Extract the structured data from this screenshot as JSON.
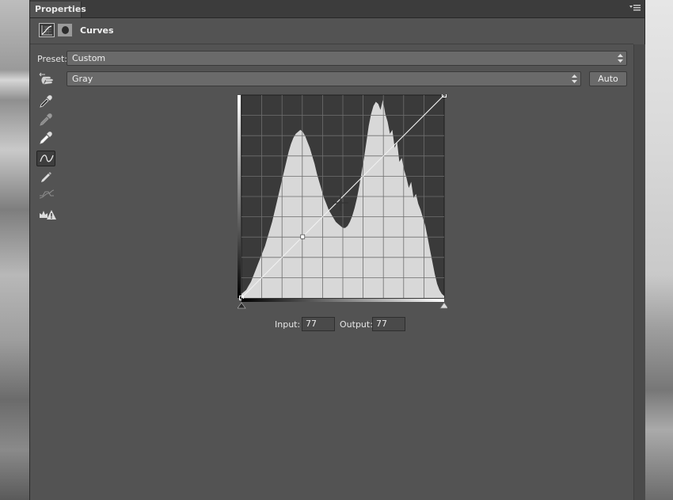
{
  "panel": {
    "tab_label": "Properties",
    "title": "Curves",
    "icons": {
      "panel_menu": "panel-menu-icon",
      "adjustment": "curves-adjustment-icon",
      "mask": "layer-mask-icon"
    }
  },
  "preset": {
    "label": "Preset:",
    "value": "Custom"
  },
  "channel": {
    "value": "Gray",
    "auto_label": "Auto"
  },
  "tools": [
    {
      "name": "on-image-adjustment-icon"
    },
    {
      "name": "black-point-eyedropper-icon"
    },
    {
      "name": "gray-point-eyedropper-icon"
    },
    {
      "name": "white-point-eyedropper-icon"
    },
    {
      "name": "edit-points-curve-icon",
      "active": true
    },
    {
      "name": "draw-curve-pencil-icon"
    },
    {
      "name": "smooth-curve-icon"
    },
    {
      "name": "clipping-warning-icon"
    }
  ],
  "curve": {
    "grid_divisions": 10,
    "input": "77",
    "output": "77",
    "input_label": "Input:",
    "output_label": "Output:",
    "points": [
      [
        0,
        0
      ],
      [
        77,
        77
      ],
      [
        255,
        255
      ]
    ],
    "histogram": [
      2,
      3,
      4,
      6,
      8,
      11,
      14,
      17,
      20,
      23,
      26,
      30,
      34,
      38,
      43,
      48,
      53,
      58,
      63,
      68,
      73,
      77,
      80,
      82,
      83,
      84,
      83,
      81,
      78,
      75,
      71,
      67,
      62,
      58,
      54,
      50,
      47,
      44,
      42,
      40,
      38,
      37,
      36,
      35,
      35,
      36,
      38,
      41,
      45,
      50,
      56,
      63,
      70,
      78,
      86,
      92,
      96,
      98,
      97,
      94,
      99,
      92,
      88,
      82,
      84,
      75,
      78,
      68,
      70,
      64,
      60,
      55,
      58,
      50,
      52,
      47,
      44,
      40,
      36,
      30,
      24,
      18,
      12,
      7,
      4,
      2,
      1
    ]
  },
  "colors": {
    "panel_bg": "#535353",
    "graph_bg": "#3a3a3a",
    "histogram": "#d8d8d8"
  }
}
